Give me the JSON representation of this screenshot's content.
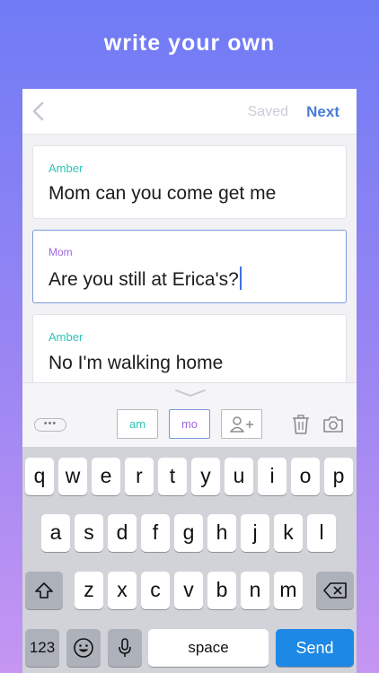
{
  "headline": "write your own",
  "navbar": {
    "saved_label": "Saved",
    "next_label": "Next"
  },
  "messages": [
    {
      "sender": "Amber",
      "text": "Mom can you come get me",
      "sender_color": "#2ec4b6"
    },
    {
      "sender": "Mom",
      "text": "Are you still at Erica's?",
      "sender_color": "#9e68de"
    },
    {
      "sender": "Amber",
      "text": "No I'm walking home",
      "sender_color": "#2ec4b6"
    }
  ],
  "toolbar": {
    "more_label": "•••",
    "chips": [
      "am",
      "mo"
    ],
    "icons": [
      "handle-chevron-icon",
      "add-person-icon",
      "trash-icon",
      "camera-icon"
    ]
  },
  "keyboard": {
    "row1": [
      "q",
      "w",
      "e",
      "r",
      "t",
      "y",
      "u",
      "i",
      "o",
      "p"
    ],
    "row2": [
      "a",
      "s",
      "d",
      "f",
      "g",
      "h",
      "j",
      "k",
      "l"
    ],
    "row3": [
      "z",
      "x",
      "c",
      "v",
      "b",
      "n",
      "m"
    ],
    "numbers_label": "123",
    "space_label": "space",
    "send_label": "Send"
  },
  "colors": {
    "accent": "#4a7bd8",
    "send_key": "#1e88e5",
    "gradient_top": "#6f7bf5",
    "gradient_bottom": "#c596f2"
  }
}
